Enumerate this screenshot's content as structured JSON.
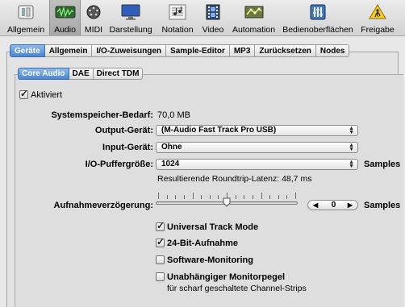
{
  "toolbar": {
    "items": [
      {
        "label": "Allgemein",
        "icon": "switch-icon"
      },
      {
        "label": "Audio",
        "icon": "audio-waveform-icon"
      },
      {
        "label": "MIDI",
        "icon": "midi-connector-icon"
      },
      {
        "label": "Darstellung",
        "icon": "monitor-icon"
      },
      {
        "label": "Notation",
        "icon": "notation-icon"
      },
      {
        "label": "Video",
        "icon": "filmstrip-icon"
      },
      {
        "label": "Automation",
        "icon": "automation-icon"
      },
      {
        "label": "Bedienoberflächen",
        "icon": "control-surface-icon"
      },
      {
        "label": "Freigabe",
        "icon": "sharing-icon"
      }
    ],
    "selected": "Audio"
  },
  "tabs": [
    "Geräte",
    "Allgemein",
    "I/O-Zuweisungen",
    "Sample-Editor",
    "MP3",
    "Zurücksetzen",
    "Nodes"
  ],
  "subtabs": [
    "Core Audio",
    "DAE",
    "Direct TDM"
  ],
  "core_audio": {
    "enabled_label": "Aktiviert",
    "enabled": true,
    "memory_label": "Systemspeicher-Bedarf:",
    "memory_value": "70,0 MB",
    "output_label": "Output-Gerät:",
    "output_value": "(M-Audio Fast Track Pro USB)",
    "input_label": "Input-Gerät:",
    "input_value": "Ohne",
    "buffer_label": "I/O-Puffergröße:",
    "buffer_value": "1024",
    "buffer_unit": "Samples",
    "latency_text": "Resultierende Roundtrip-Latenz: 48,7 ms",
    "delay_label": "Aufnahmeverzögerung:",
    "delay_value": "0",
    "delay_unit": "Samples",
    "delay_slider_level": 0.5,
    "options": [
      {
        "label": "Universal Track Mode",
        "checked": true
      },
      {
        "label": "24-Bit-Aufnahme",
        "checked": true
      },
      {
        "label": "Software-Monitoring",
        "checked": false
      },
      {
        "label": "Unabhängiger Monitorpegel",
        "sub": "für scharf geschaltete Channel-Strips",
        "checked": false
      }
    ]
  },
  "colors": {
    "accent": "#4a86d4",
    "window_bg": "#e8e8e8"
  }
}
